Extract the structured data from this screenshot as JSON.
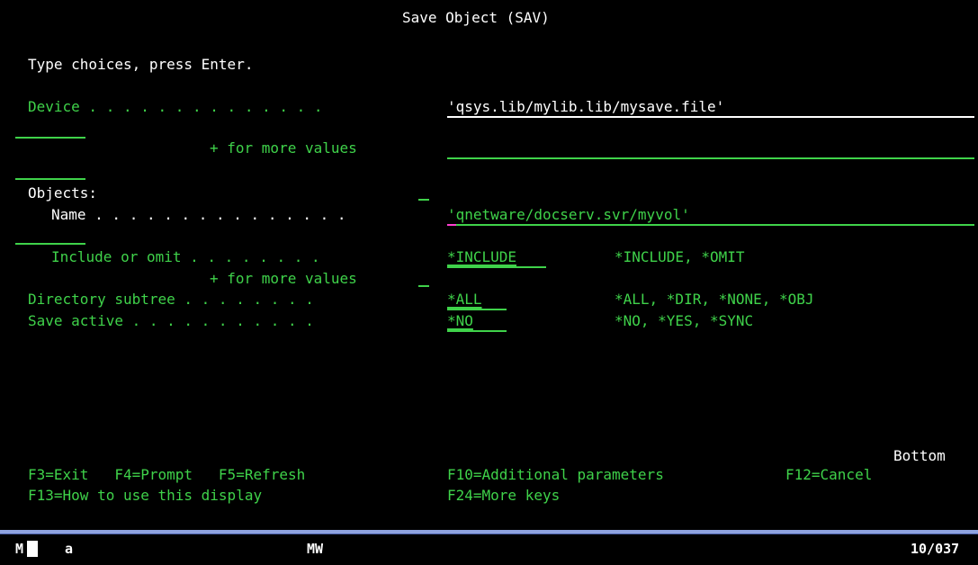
{
  "screen": {
    "title": "Save Object (SAV)",
    "instructions": "Type choices, press Enter."
  },
  "fields": {
    "device_label": "Device . . . . . . . . . . . . . .",
    "device_value": "'qsys.lib/mylib.lib/mysave.file'",
    "more_values_1": "+ for more values",
    "objects_label": "Objects:",
    "name_label": "Name . . . . . . . . . . . . . . .",
    "name_value": "'qnetware/docserv.svr/myvol'",
    "include_label": "Include or omit . . . . . . . .",
    "include_value": "*INCLUDE",
    "include_choices": "*INCLUDE, *OMIT",
    "more_values_2": "+ for more values",
    "subtree_label": "Directory subtree . . . . . . . .",
    "subtree_value": "*ALL",
    "subtree_choices": "*ALL, *DIR, *NONE, *OBJ",
    "active_label": "Save active . . . . . . . . . . .",
    "active_value": "*NO",
    "active_choices": "*NO, *YES, *SYNC"
  },
  "footer": {
    "position": "Bottom",
    "keys_row1": "F3=Exit   F4=Prompt   F5=Refresh",
    "keys_row1b": "F10=Additional parameters",
    "keys_row1c": "F12=Cancel",
    "keys_row2": "F13=How to use this display",
    "keys_row2b": "F24=More keys"
  },
  "status_bar": {
    "indicator": "M",
    "session": "a",
    "mode": "MW",
    "cursor_pos": "10/037"
  }
}
